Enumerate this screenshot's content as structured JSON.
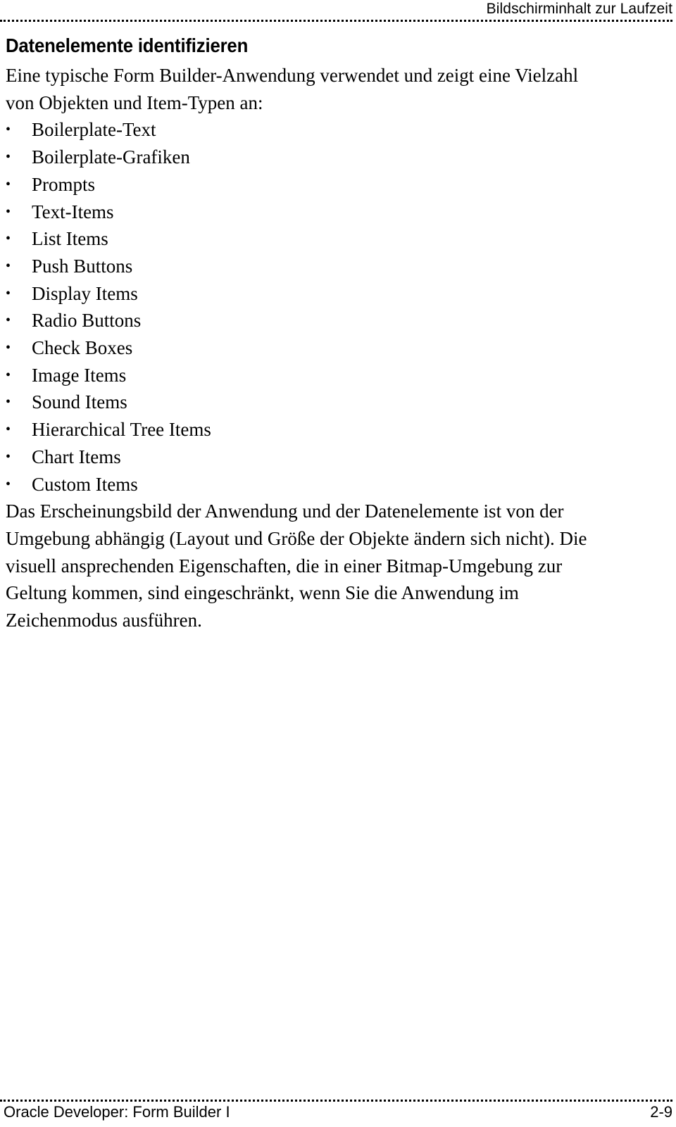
{
  "header": {
    "running_title": "Bildschirminhalt zur Laufzeit"
  },
  "heading": {
    "title": "Datenelemente identifizieren"
  },
  "intro_paragraph": {
    "lines": [
      "Eine typische Form Builder-Anwendung verwendet und zeigt eine Vielzahl",
      "von Objekten und Item-Typen an:"
    ]
  },
  "bullet_list": {
    "marker": "•",
    "items": [
      {
        "label": "Boilerplate-Text"
      },
      {
        "label": "Boilerplate-Grafiken"
      },
      {
        "label": "Prompts"
      },
      {
        "label": "Text-Items"
      },
      {
        "label": "List Items"
      },
      {
        "label": "Push Buttons"
      },
      {
        "label": "Display Items"
      },
      {
        "label": "Radio Buttons"
      },
      {
        "label": "Check Boxes"
      },
      {
        "label": "Image Items"
      },
      {
        "label": "Sound Items"
      },
      {
        "label": "Hierarchical Tree Items"
      },
      {
        "label": "Chart Items"
      },
      {
        "label": "Custom Items"
      }
    ]
  },
  "closing_paragraph": {
    "lines": [
      "Das Erscheinungsbild der Anwendung und der Datenelemente ist von der",
      "Umgebung abhängig (Layout und Größe der Objekte ändern sich nicht). Die",
      "visuell ansprechenden Eigenschaften, die in einer Bitmap-Umgebung zur",
      "Geltung kommen, sind eingeschränkt, wenn Sie die Anwendung im",
      "Zeichenmodus ausführen."
    ]
  },
  "footer": {
    "course_title": "Oracle Developer: Form Builder I",
    "page_number": "2-9"
  },
  "colors": {
    "text": "#000000",
    "background": "#ffffff",
    "rule": "#000000"
  }
}
